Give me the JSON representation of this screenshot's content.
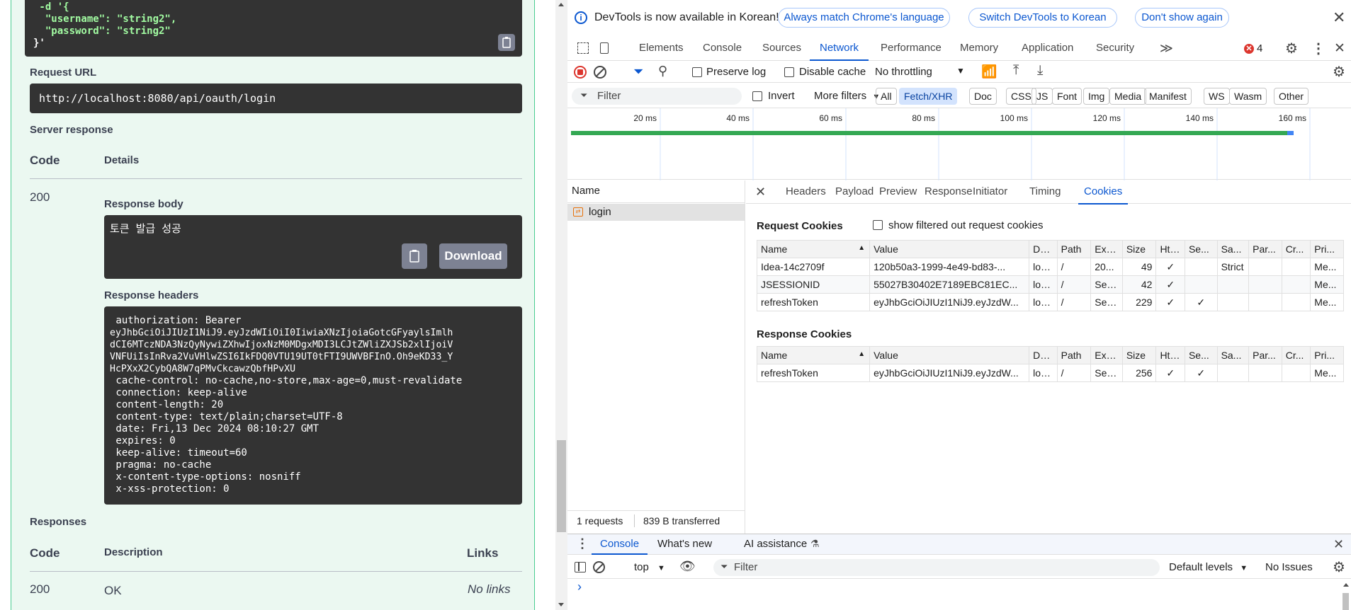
{
  "swagger": {
    "curl_lines": [
      " -d '{",
      "  \"username\": \"string2\",",
      "  \"password\": \"string2\"",
      "}'"
    ],
    "request_url_label": "Request URL",
    "request_url": "http://localhost:8080/api/oauth/login",
    "server_response_label": "Server response",
    "col_code": "Code",
    "col_details": "Details",
    "status_code": "200",
    "response_body_label": "Response body",
    "response_body": "토큰 발급 성공",
    "download_label": "Download",
    "response_headers_label": "Response headers",
    "response_headers": [
      " authorization: Bearer",
      "eyJhbGciOiJIUzI1NiJ9.eyJzdWIiOiI0IiwiaXNzIjoiaGotcGFyaylsImlh",
      "dCI6MTczNDA3NzQyNywiZXhwIjoxNzM0MDgxMDI3LCJtZWliZXJSb2xlIjoiV",
      "VNFUiIsInRva2VuVHlwZSI6IkFDQ0VTU19UT0tFTI9UWVBFInO.Oh9eKD33_Y",
      "HcPXxX2CybQA8W7qPMvCkcawzQbfHPvXU",
      " cache-control: no-cache,no-store,max-age=0,must-revalidate",
      " connection: keep-alive",
      " content-length: 20",
      " content-type: text/plain;charset=UTF-8",
      " date: Fri,13 Dec 2024 08:10:27 GMT",
      " expires: 0",
      " keep-alive: timeout=60",
      " pragma: no-cache",
      " x-content-type-options: nosniff",
      " x-xss-protection: 0"
    ],
    "responses_label": "Responses",
    "col_description": "Description",
    "col_links": "Links",
    "resp_code": "200",
    "resp_description": "OK",
    "resp_links": "No links"
  },
  "devtools": {
    "infobar": {
      "text": "DevTools is now available in Korean!",
      "btn_match": "Always match Chrome's language",
      "btn_switch": "Switch DevTools to Korean",
      "btn_dont": "Don't show again"
    },
    "main_tabs": [
      "Elements",
      "Console",
      "Sources",
      "Network",
      "Performance",
      "Memory",
      "Application",
      "Security"
    ],
    "active_main_tab": "Network",
    "more_tabs": "≫",
    "error_count": "4",
    "toolbar": {
      "preserve_log": "Preserve log",
      "disable_cache": "Disable cache",
      "throttling": "No throttling"
    },
    "filter": {
      "placeholder": "Filter",
      "invert": "Invert",
      "more_filters": "More filters",
      "types": [
        "All",
        "Fetch/XHR",
        "Doc",
        "CSS",
        "JS",
        "Font",
        "Img",
        "Media",
        "Manifest",
        "WS",
        "Wasm",
        "Other"
      ],
      "active_type": "Fetch/XHR"
    },
    "timeline_ticks": [
      "20 ms",
      "40 ms",
      "60 ms",
      "80 ms",
      "100 ms",
      "120 ms",
      "140 ms",
      "160 ms"
    ],
    "name_header": "Name",
    "requests": [
      "login"
    ],
    "detail_tabs": [
      "Headers",
      "Payload",
      "Preview",
      "Response",
      "Initiator",
      "Timing",
      "Cookies"
    ],
    "active_detail_tab": "Cookies",
    "request_cookies_title": "Request Cookies",
    "show_filtered": "show filtered out request cookies",
    "cookie_columns": [
      "Name",
      "Value",
      "Do...",
      "Path",
      "Exp...",
      "Size",
      "Htt...",
      "Se...",
      "Sa...",
      "Par...",
      "Cr...",
      "Pri..."
    ],
    "request_cookies": [
      [
        "Idea-14c2709f",
        "120b50a3-1999-4e49-bd83-...",
        "loc...",
        "/",
        "20...",
        "49",
        "✓",
        "",
        "Strict",
        "",
        "",
        "Me..."
      ],
      [
        "JSESSIONID",
        "55027B30402E7189EBC81EC...",
        "loc...",
        "/",
        "Ses...",
        "42",
        "✓",
        "",
        "",
        "",
        "",
        "Me..."
      ],
      [
        "refreshToken",
        "eyJhbGciOiJIUzI1NiJ9.eyJzdW...",
        "loc...",
        "/",
        "Ses...",
        "229",
        "✓",
        "✓",
        "",
        "",
        "",
        "Me..."
      ]
    ],
    "response_cookies_title": "Response Cookies",
    "response_cookies": [
      [
        "refreshToken",
        "eyJhbGciOiJIUzI1NiJ9.eyJzdW...",
        "loc...",
        "/",
        "Ses...",
        "256",
        "✓",
        "✓",
        "",
        "",
        "",
        "Me..."
      ]
    ],
    "status": {
      "requests": "1 requests",
      "transferred": "839 B transferred"
    },
    "drawer": {
      "tabs": [
        "Console",
        "What's new",
        "AI assistance"
      ],
      "active": "Console",
      "context": "top",
      "filter_placeholder": "Filter",
      "levels": "Default levels",
      "issues": "No Issues",
      "prompt": "›"
    }
  },
  "colors": {
    "accent": "#0b57d0",
    "swagger_bg": "#ebf8f1",
    "swagger_border": "#49cc90",
    "error": "#dc362e",
    "timeline_bar": "#34a853"
  }
}
